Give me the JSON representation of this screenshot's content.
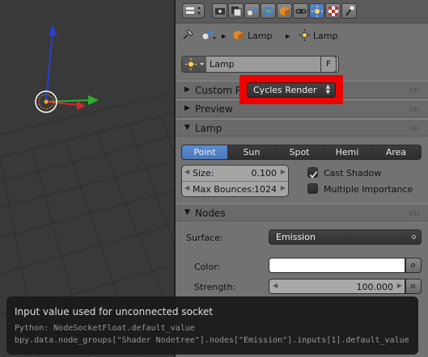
{
  "breadcrumbs": {
    "object": "Lamp",
    "data": "Lamp"
  },
  "datablock": {
    "name": "Lamp",
    "fake_user": "F"
  },
  "panels": {
    "custom_props": "Custom Pr",
    "preview": "Preview",
    "lamp": "Lamp",
    "nodes": "Nodes"
  },
  "render_engine": {
    "selected": "Cycles Render",
    "highlight_color": "#ee0000"
  },
  "lamp_types": {
    "point": "Point",
    "sun": "Sun",
    "spot": "Spot",
    "hemi": "Hemi",
    "area": "Area",
    "selected": "Point"
  },
  "size": {
    "label": "Size:",
    "value": "0.100"
  },
  "max_bounces": {
    "label": "Max Bounces:",
    "value": "1024"
  },
  "cast_shadow": {
    "label": "Cast Shadow",
    "checked": true
  },
  "multiple_importance": {
    "label": "Multiple Importance",
    "checked": false
  },
  "nodes": {
    "surface_label": "Surface:",
    "surface_value": "Emission",
    "color_label": "Color:",
    "color_value": "#ffffff",
    "strength_label": "Strength:",
    "strength_value": "100.000"
  },
  "tooltip": {
    "title": "Input value used for unconnected socket",
    "python": "Python: NodeSocketFloat.default_value",
    "path": "bpy.data.node_groups[\"Shader Nodetree\"].nodes[\"Emission\"].inputs[1].default_value"
  },
  "icons": [
    "editor-type-icon",
    "render-icon",
    "render-layers-icon",
    "scene-icon",
    "world-icon",
    "object-icon",
    "constraints-icon",
    "modifiers-icon",
    "lamp-data-icon",
    "texture-icon",
    "particles-icon",
    "physics-icon",
    "pin-icon"
  ]
}
